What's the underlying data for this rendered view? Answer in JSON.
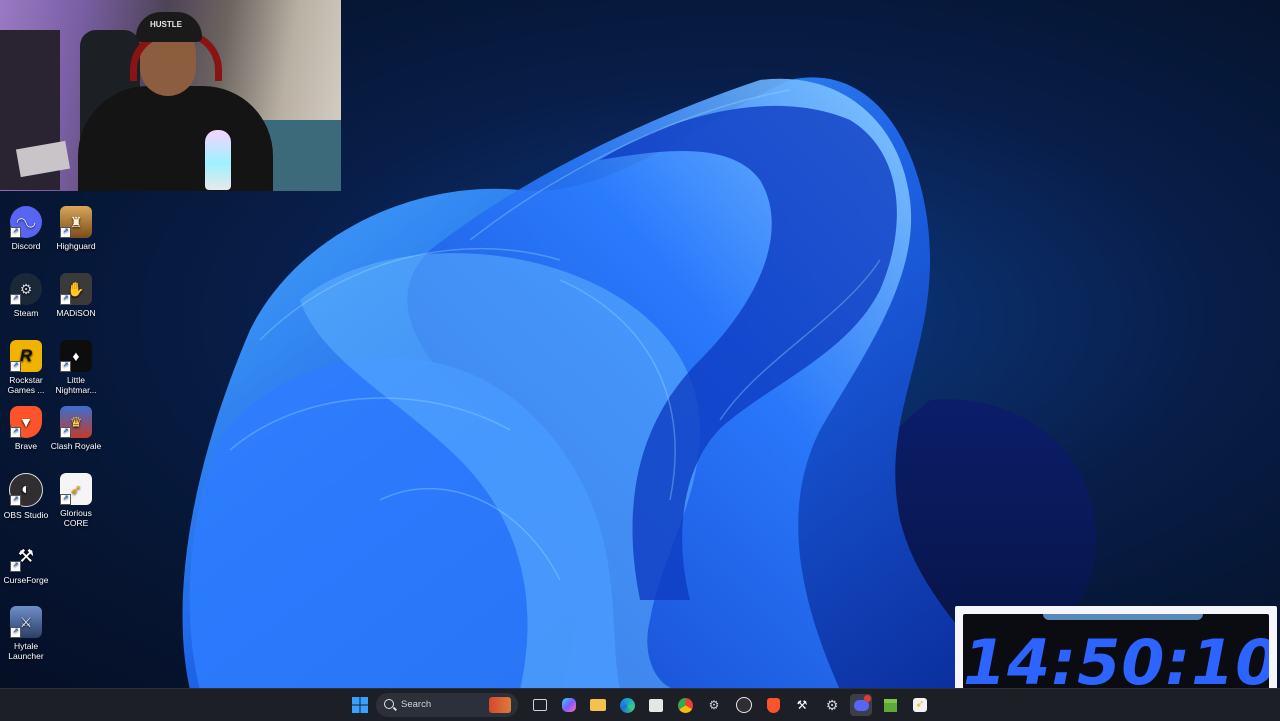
{
  "desktop": {
    "icons": [
      {
        "label": "Discord",
        "icon": "discord-icon",
        "color": "#5865F2",
        "glyph": "◉"
      },
      {
        "label": "Highguard",
        "icon": "highguard-icon",
        "color": "#3a2a14",
        "glyph": "♜"
      },
      {
        "label": "Steam",
        "icon": "steam-icon",
        "color": "#1b2838",
        "glyph": "⚙"
      },
      {
        "label": "MADiSON",
        "icon": "madison-icon",
        "color": "#444444",
        "glyph": "✋"
      },
      {
        "label": "Rockstar Games ...",
        "icon": "rockstar-icon",
        "color": "#f0b400",
        "glyph": "R"
      },
      {
        "label": "Little Nightmar...",
        "icon": "little-nightmares-icon",
        "color": "#111111",
        "glyph": "♦"
      },
      {
        "label": "Brave",
        "icon": "brave-icon",
        "color": "#fb542b",
        "glyph": "▼"
      },
      {
        "label": "Clash Royale",
        "icon": "clash-royale-icon",
        "color": "#3b6fd0",
        "glyph": "♛"
      },
      {
        "label": "OBS Studio",
        "icon": "obs-icon",
        "color": "#302e31",
        "glyph": "●"
      },
      {
        "label": "Glorious CORE",
        "icon": "glorious-icon",
        "color": "#f3f3f3",
        "glyph": "➶"
      },
      {
        "label": "CurseForge",
        "icon": "curseforge-icon",
        "color": "#1a1a1a",
        "glyph": "⚒"
      },
      {
        "label": "Hytale Launcher",
        "icon": "hytale-icon",
        "color": "#2c3e66",
        "glyph": "⚔"
      }
    ]
  },
  "webcam": {
    "cap_text": "HUSTLE"
  },
  "clock": {
    "time": "14:50:10"
  },
  "taskbar": {
    "search_placeholder": "Search",
    "items": [
      {
        "name": "start-button",
        "icon": "windows-icon",
        "color": "#3aa0ff"
      },
      {
        "name": "task-view-button",
        "icon": "task-view-icon",
        "color": "#7a8290"
      },
      {
        "name": "copilot-button",
        "icon": "copilot-icon",
        "color": "#7a5cff"
      },
      {
        "name": "file-explorer-button",
        "icon": "folder-icon",
        "color": "#f2c14e"
      },
      {
        "name": "edge-button",
        "icon": "edge-icon",
        "color": "#1aa0d8"
      },
      {
        "name": "store-button",
        "icon": "store-icon",
        "color": "#e6e6e6"
      },
      {
        "name": "chrome-button",
        "icon": "chrome-icon",
        "color": "#e94235"
      },
      {
        "name": "steam-taskbar-button",
        "icon": "steam-icon",
        "color": "#1b2838"
      },
      {
        "name": "obs-taskbar-button",
        "icon": "obs-icon",
        "color": "#302e31"
      },
      {
        "name": "brave-taskbar-button",
        "icon": "brave-icon",
        "color": "#fb542b"
      },
      {
        "name": "curseforge-taskbar-button",
        "icon": "curseforge-icon",
        "color": "#1a1a1a"
      },
      {
        "name": "settings-taskbar-button",
        "icon": "gear-icon",
        "color": "#555a63"
      },
      {
        "name": "discord-taskbar-button",
        "icon": "discord-icon",
        "color": "#5865F2"
      },
      {
        "name": "minecraft-taskbar-button",
        "icon": "minecraft-icon",
        "color": "#5fa83a"
      },
      {
        "name": "glorious-taskbar-button",
        "icon": "glorious-icon",
        "color": "#f3f3f3"
      }
    ]
  }
}
